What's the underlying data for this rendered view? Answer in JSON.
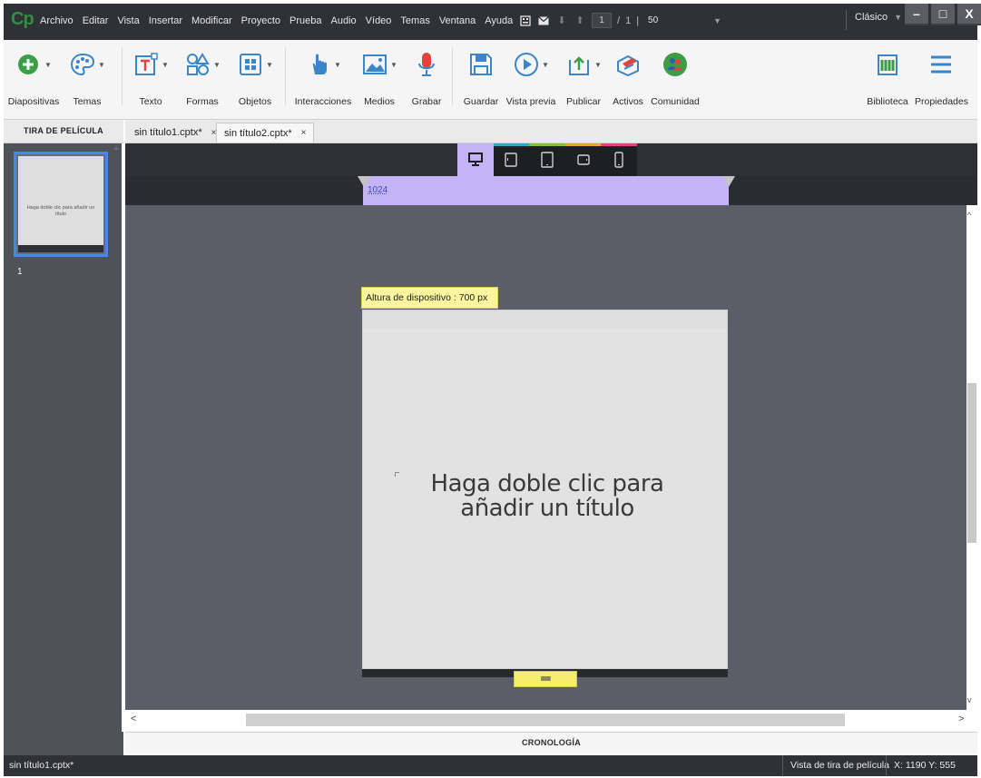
{
  "app": {
    "logo": "Cp",
    "menus": [
      "Archivo",
      "Editar",
      "Vista",
      "Insertar",
      "Modificar",
      "Proyecto",
      "Prueba",
      "Audio",
      "Vídeo",
      "Temas",
      "Ventana",
      "Ayuda"
    ],
    "page_current": "1",
    "page_sep": "/",
    "page_total": "1",
    "bar": "|",
    "zoom": "50",
    "mode": "Clásico",
    "win_min": "–",
    "win_max": "□",
    "win_close": "X"
  },
  "ribbon": {
    "diapositivas": "Diapositivas",
    "temas": "Temas",
    "texto": "Texto",
    "formas": "Formas",
    "objetos": "Objetos",
    "interacciones": "Interacciones",
    "medios": "Medios",
    "grabar": "Grabar",
    "guardar": "Guardar",
    "vista_previa": "Vista previa",
    "publicar": "Publicar",
    "activos": "Activos",
    "comunidad": "Comunidad",
    "biblioteca": "Biblioteca",
    "propiedades": "Propiedades"
  },
  "filmstrip": {
    "header": "TIRA DE PELÍCULA",
    "thumb_text": "Haga doble clic para añadir un título",
    "slide_number": "1"
  },
  "tabs": [
    {
      "label": "sin título1.cptx*",
      "close": "×"
    },
    {
      "label": "sin título2.cptx*",
      "close": "×"
    }
  ],
  "stage": {
    "ruler_width": "1024",
    "device_height_label": "Altura de dispositivo : 700 px",
    "slide_title": "Haga doble clic para añadir un título",
    "handle_text": "IIIIIIIIIII",
    "scroll_up": "^",
    "scroll_down": "v",
    "scroll_left": "<",
    "scroll_right": ">"
  },
  "devices": [
    {
      "name": "desktop",
      "color": "#c5b3f7",
      "selected": true
    },
    {
      "name": "tablet-landscape",
      "color": "#3aa0c8",
      "selected": false
    },
    {
      "name": "tablet-portrait",
      "color": "#7cc043",
      "selected": false
    },
    {
      "name": "phone-landscape",
      "color": "#e3a33b",
      "selected": false
    },
    {
      "name": "phone-portrait",
      "color": "#d9487a",
      "selected": false
    }
  ],
  "timeline": {
    "label": "CRONOLOGÍA"
  },
  "status": {
    "file": "sin título1.cptx*",
    "view": "Vista de tira de película",
    "coords": "X: 1190 Y: 555"
  }
}
